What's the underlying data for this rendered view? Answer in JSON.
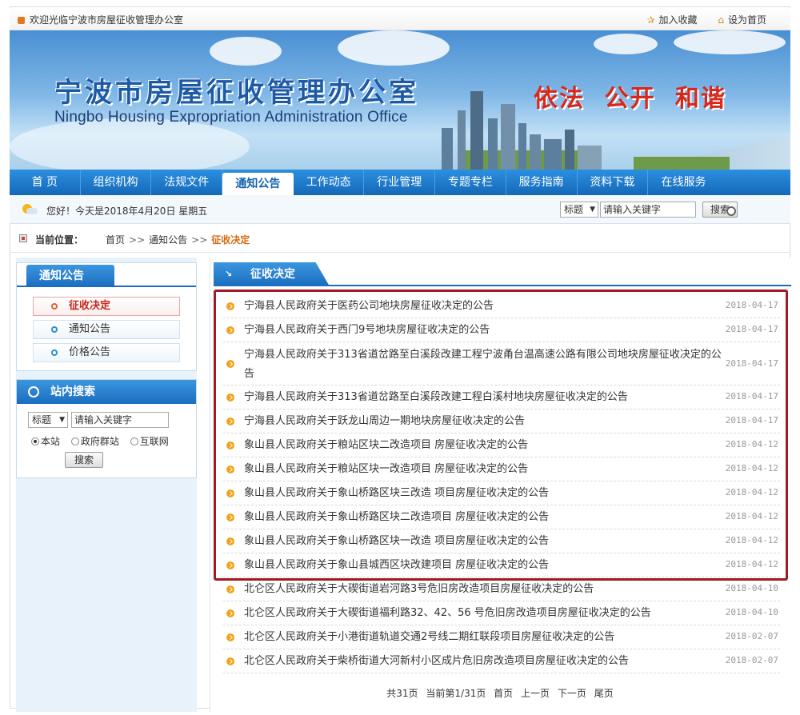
{
  "topbar": {
    "welcome": "欢迎光临宁波市房屋征收管理办公室",
    "bookmark": "加入收藏",
    "homepage": "设为首页"
  },
  "banner": {
    "title_cn": "宁波市房屋征收管理办公室",
    "title_en": "Ningbo Housing Expropriation Administration Office",
    "slogan": "依法 公开 和谐"
  },
  "nav": [
    {
      "label": "首 页"
    },
    {
      "label": "组织机构"
    },
    {
      "label": "法规文件"
    },
    {
      "label": "通知公告",
      "active": true
    },
    {
      "label": "工作动态"
    },
    {
      "label": "行业管理"
    },
    {
      "label": "专题专栏"
    },
    {
      "label": "服务指南"
    },
    {
      "label": "资料下载"
    },
    {
      "label": "在线服务"
    }
  ],
  "infobar": {
    "greeting": "您好！今天是2018年4月20日 星期五",
    "select": "标题",
    "keyword": "请输入关键字",
    "search_btn": "搜索"
  },
  "breadcrumb": {
    "label": "当前位置：",
    "home": "首页",
    "section": "通知公告",
    "current": "征收决定",
    "sep": ">>"
  },
  "sidebar": {
    "heading": "通知公告",
    "items": [
      {
        "label": "征收决定",
        "active": true
      },
      {
        "label": "通知公告"
      },
      {
        "label": "价格公告"
      }
    ],
    "search": {
      "heading": "站内搜索",
      "select": "标题",
      "keyword": "请输入关键字",
      "radios": [
        "本站",
        "政府群站",
        "互联网"
      ],
      "button": "搜索"
    }
  },
  "main": {
    "heading": "征收决定",
    "rows": [
      {
        "title": "宁海县人民政府关于医药公司地块房屋征收决定的公告",
        "date": "2018-04-17"
      },
      {
        "title": "宁海县人民政府关于西门9号地块房屋征收决定的公告",
        "date": "2018-04-17"
      },
      {
        "title": "宁海县人民政府关于313省道岔路至白溪段改建工程宁波甬台温高速公路有限公司地块房屋征收决定的公告",
        "date": "2018-04-17",
        "tall": true
      },
      {
        "title": "宁海县人民政府关于313省道岔路至白溪段改建工程白溪村地块房屋征收决定的公告",
        "date": "2018-04-17"
      },
      {
        "title": "宁海县人民政府关于跃龙山周边一期地块房屋征收决定的公告",
        "date": "2018-04-17"
      },
      {
        "title": "象山县人民政府关于粮站区块二改造项目 房屋征收决定的公告",
        "date": "2018-04-12"
      },
      {
        "title": "象山县人民政府关于粮站区块一改造项目 房屋征收决定的公告",
        "date": "2018-04-12"
      },
      {
        "title": "象山县人民政府关于象山桥路区块三改造 项目房屋征收决定的公告",
        "date": "2018-04-12"
      },
      {
        "title": "象山县人民政府关于象山桥路区块二改造项目 房屋征收决定的公告",
        "date": "2018-04-12"
      },
      {
        "title": "象山县人民政府关于象山桥路区块一改造 项目房屋征收决定的公告",
        "date": "2018-04-12"
      },
      {
        "title": "象山县人民政府关于象山县城西区块改建项目 房屋征收决定的公告",
        "date": "2018-04-12"
      },
      {
        "title": "北仑区人民政府关于大碶街道岩河路3号危旧房改造项目房屋征收决定的公告",
        "date": "2018-04-10"
      },
      {
        "title": "北仑区人民政府关于大碶街道福利路32、42、56 号危旧房改造项目房屋征收决定的公告",
        "date": "2018-04-10"
      },
      {
        "title": "北仑区人民政府关于小港街道轨道交通2号线二期红联段项目房屋征收决定的公告",
        "date": "2018-02-07"
      },
      {
        "title": "北仑区人民政府关于柴桥街道大河新村小区成片危旧房改造项目房屋征收决定的公告",
        "date": "2018-02-07"
      }
    ]
  },
  "pager": {
    "total": "共31页",
    "current": "当前第1/31页",
    "first": "首页",
    "prev": "上一页",
    "next": "下一页",
    "last": "尾页"
  },
  "colors": {
    "nav_blue": "#1a6dbf",
    "highlight_red": "#a31a22",
    "bullet_orange": "#f2a21b",
    "slogan_red": "#d8281c"
  }
}
